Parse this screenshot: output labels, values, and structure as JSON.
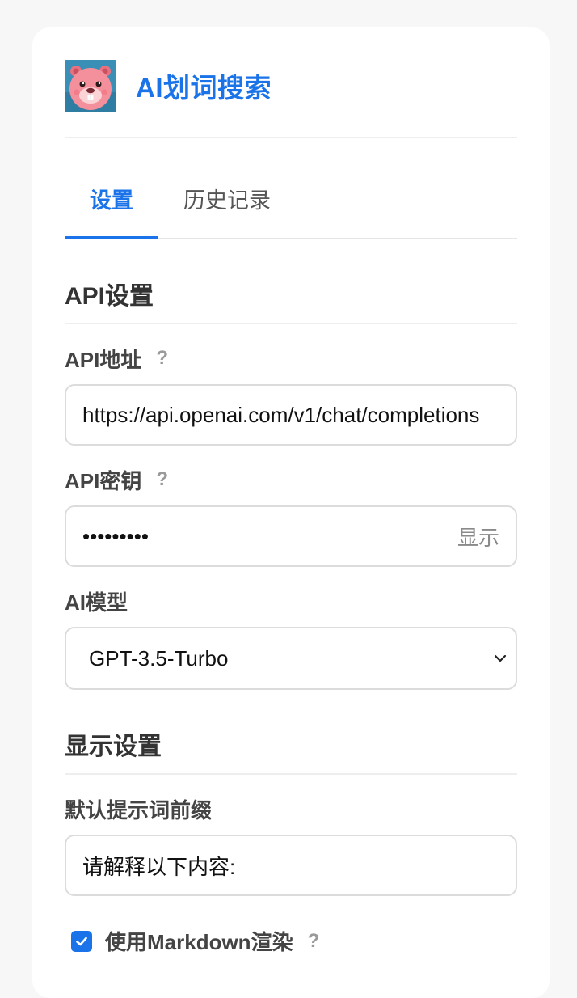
{
  "app": {
    "title": "AI划词搜索",
    "logo_icon": "beaver-mascot-icon"
  },
  "tabs": [
    {
      "label": "设置",
      "active": true
    },
    {
      "label": "历史记录",
      "active": false
    }
  ],
  "api_settings": {
    "section_title": "API设置",
    "api_url": {
      "label": "API地址",
      "help": "?",
      "value": "https://api.openai.com/v1/chat/completions"
    },
    "api_key": {
      "label": "API密钥",
      "help": "?",
      "masked_value": "•••••••••",
      "toggle_label": "显示"
    },
    "model": {
      "label": "AI模型",
      "selected": "GPT-3.5-Turbo"
    }
  },
  "display_settings": {
    "section_title": "显示设置",
    "prompt_prefix": {
      "label": "默认提示词前缀",
      "value": "请解释以下内容:"
    },
    "markdown": {
      "label": "使用Markdown渲染",
      "help": "?",
      "checked": true
    }
  },
  "colors": {
    "accent": "#1a73e8",
    "background": "#f7f7f7",
    "card": "#ffffff"
  }
}
